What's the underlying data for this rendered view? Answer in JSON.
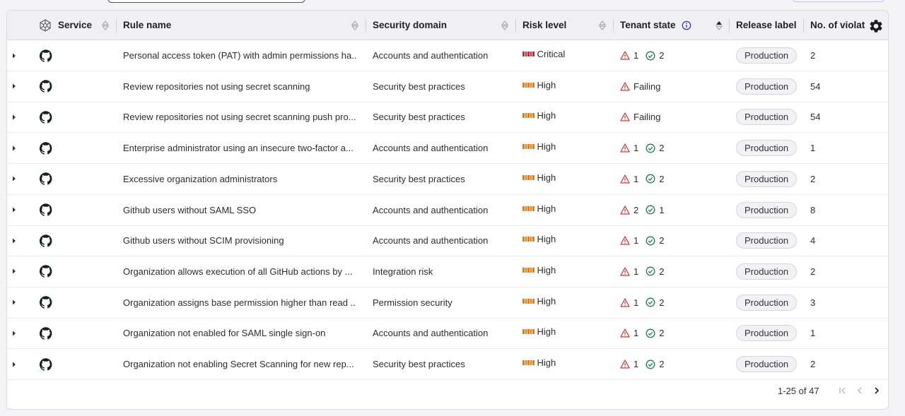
{
  "columns": {
    "service": "Service",
    "rule_name": "Rule name",
    "security_domain": "Security domain",
    "risk_level": "Risk level",
    "tenant_state": "Tenant state",
    "release_label": "Release label",
    "violations": "No. of violati"
  },
  "colors": {
    "critical": "#d0262e",
    "high": "#ee7a12",
    "warning": "#d23b3b",
    "pass": "#1f7a52"
  },
  "rows": [
    {
      "rule": "Personal access token (PAT) with admin permissions ha...",
      "domain": "Accounts and authentication",
      "risk": "Critical",
      "fail_text": "1",
      "pass_text": "2",
      "release": "Production",
      "violations": "2"
    },
    {
      "rule": "Review repositories not using secret scanning",
      "domain": "Security best practices",
      "risk": "High",
      "fail_text": "Failing",
      "pass_text": "",
      "release": "Production",
      "violations": "54"
    },
    {
      "rule": "Review repositories not using secret scanning push pro...",
      "domain": "Security best practices",
      "risk": "High",
      "fail_text": "Failing",
      "pass_text": "",
      "release": "Production",
      "violations": "54"
    },
    {
      "rule": "Enterprise administrator using an insecure two-factor a...",
      "domain": "Accounts and authentication",
      "risk": "High",
      "fail_text": "1",
      "pass_text": "2",
      "release": "Production",
      "violations": "1"
    },
    {
      "rule": "Excessive organization administrators",
      "domain": "Security best practices",
      "risk": "High",
      "fail_text": "1",
      "pass_text": "2",
      "release": "Production",
      "violations": "2"
    },
    {
      "rule": "Github users without SAML SSO",
      "domain": "Accounts and authentication",
      "risk": "High",
      "fail_text": "2",
      "pass_text": "1",
      "release": "Production",
      "violations": "8"
    },
    {
      "rule": "Github users without SCIM provisioning",
      "domain": "Accounts and authentication",
      "risk": "High",
      "fail_text": "1",
      "pass_text": "2",
      "release": "Production",
      "violations": "4"
    },
    {
      "rule": "Organization allows execution of all GitHub actions by ...",
      "domain": "Integration risk",
      "risk": "High",
      "fail_text": "1",
      "pass_text": "2",
      "release": "Production",
      "violations": "2"
    },
    {
      "rule": "Organization assigns base permission higher than read ...",
      "domain": "Permission security",
      "risk": "High",
      "fail_text": "1",
      "pass_text": "2",
      "release": "Production",
      "violations": "3"
    },
    {
      "rule": "Organization not enabled for SAML single sign-on",
      "domain": "Accounts and authentication",
      "risk": "High",
      "fail_text": "1",
      "pass_text": "2",
      "release": "Production",
      "violations": "1"
    },
    {
      "rule": "Organization not enabling Secret Scanning for new rep...",
      "domain": "Security best practices",
      "risk": "High",
      "fail_text": "1",
      "pass_text": "2",
      "release": "Production",
      "violations": "2"
    }
  ],
  "pagination": {
    "range": "1-25 of 47"
  }
}
